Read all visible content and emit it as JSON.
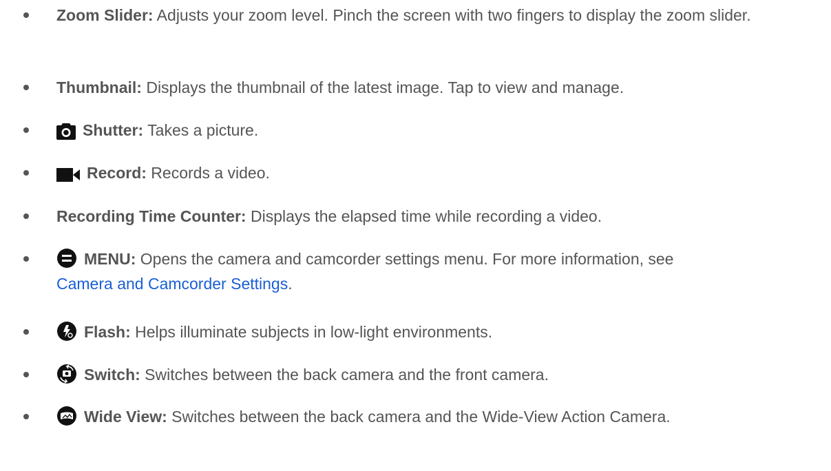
{
  "items": [
    {
      "term": "Zoom Slider:",
      "desc": " Adjusts your zoom level. Pinch the screen with two fingers to display the zoom slider."
    },
    {
      "term": "Thumbnail:",
      "desc": " Displays the thumbnail of the latest image. Tap to view and manage."
    },
    {
      "icon": "camera-shutter-icon",
      "term": "Shutter:",
      "desc": " Takes a picture."
    },
    {
      "icon": "video-camera-icon",
      "term": "Record:",
      "desc": " Records a video."
    },
    {
      "term": "Recording Time Counter:",
      "desc": " Displays the elapsed time while recording a video."
    },
    {
      "icon": "menu-circle-icon",
      "term": "MENU:",
      "desc": " Opens the camera and camcorder settings menu. For more information, see",
      "link": "Camera and Camcorder Settings",
      "after_link": "."
    },
    {
      "icon": "flash-icon",
      "term": "Flash:",
      "desc": " Helps illuminate subjects in low-light environments."
    },
    {
      "icon": "switch-camera-icon",
      "term": "Switch:",
      "desc": " Switches between the back camera and the front camera."
    },
    {
      "icon": "wide-view-icon",
      "term": "Wide View:",
      "desc": " Switches between the back camera and the Wide-View Action Camera."
    }
  ]
}
